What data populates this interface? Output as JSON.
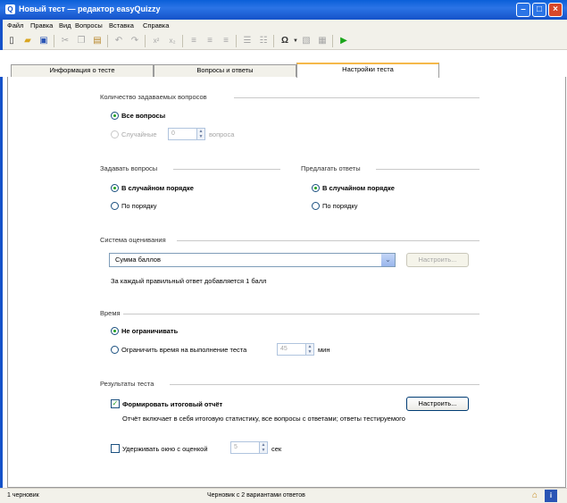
{
  "window": {
    "title": "Новый тест — редактор easyQuizzy"
  },
  "menu": [
    "Файл",
    "Правка",
    "Вид",
    "Вопросы",
    "Вставка",
    "Справка"
  ],
  "toolbar": {
    "icons": [
      "new-doc-icon",
      "open-folder-icon",
      "save-icon",
      "cut-icon",
      "copy-icon",
      "paste-icon",
      "undo-icon",
      "redo-icon",
      "superscript-icon",
      "subscript-icon",
      "align-left-icon",
      "align-center-icon",
      "align-right-icon",
      "numbered-list-icon",
      "bullet-list-icon",
      "omega-symbol-icon",
      "image-icon",
      "table-icon",
      "run-icon"
    ],
    "omega_glyph": "Ω",
    "superscript_glyph": "x²",
    "subscript_glyph": "x₂"
  },
  "tabs": [
    {
      "label": "Информация о тесте",
      "active": false
    },
    {
      "label": "Вопросы и ответы",
      "active": false
    },
    {
      "label": "Настройки теста",
      "active": true
    }
  ],
  "questions_count": {
    "title": "Количество задаваемых вопросов",
    "all_label": "Все вопросы",
    "random_label": "Случайные",
    "random_value": "0",
    "random_suffix": "вопроса"
  },
  "ask_questions": {
    "title": "Задавать вопросы",
    "random_label": "В случайном порядке",
    "ordered_label": "По порядку"
  },
  "offer_answers": {
    "title": "Предлагать ответы",
    "random_label": "В случайном порядке",
    "ordered_label": "По порядку"
  },
  "grading": {
    "title": "Система оценивания",
    "selected": "Сумма баллов",
    "configure_label": "Настроить...",
    "description": "За каждый правильный ответ добавляется 1 балл"
  },
  "time": {
    "title": "Время",
    "unlimited_label": "Не ограничивать",
    "limit_label": "Ограничить время на выполнение теста",
    "limit_value": "45",
    "limit_unit": "мин"
  },
  "results": {
    "title": "Результаты теста",
    "report_label": "Формировать итоговый отчёт",
    "configure_label": "Настроить...",
    "report_description": "Отчёт включает в себя итоговую статистику, все вопросы с ответами; ответы тестируемого",
    "hold_window_label": "Удерживать окно с оценкой",
    "hold_value": "5",
    "hold_unit": "сек"
  },
  "status": {
    "left": "1 черновик",
    "center": "Черновик с 2 вариантами ответов"
  },
  "colors": {
    "title_bar": "#1552c9",
    "tab_accent": "#f5b84a",
    "radio_dot": "#21a121"
  }
}
